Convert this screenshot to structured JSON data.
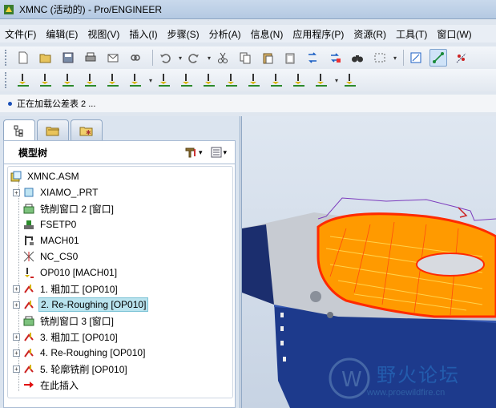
{
  "window": {
    "title": "XMNC (活动的) - Pro/ENGINEER"
  },
  "menu": [
    "文件(F)",
    "编辑(E)",
    "视图(V)",
    "插入(I)",
    "步骤(S)",
    "分析(A)",
    "信息(N)",
    "应用程序(P)",
    "资源(R)",
    "工具(T)",
    "窗口(W)"
  ],
  "status": {
    "message": "正在加载公差表 2 ..."
  },
  "panel": {
    "title": "模型树",
    "tabs": [
      "model-tree-tab",
      "layer-tab",
      "favorites-tab"
    ]
  },
  "tree": [
    {
      "label": "XMNC.ASM",
      "icon": "assembly-icon",
      "expandable": false,
      "indent": 0
    },
    {
      "label": "XIAMO_.PRT",
      "icon": "part-icon",
      "expandable": true,
      "indent": 1
    },
    {
      "label": "铣削窗口 2 [窗口]",
      "icon": "mill-window-icon",
      "expandable": false,
      "indent": 1
    },
    {
      "label": "FSETP0",
      "icon": "fixture-icon",
      "expandable": false,
      "indent": 1
    },
    {
      "label": "MACH01",
      "icon": "machine-icon",
      "expandable": false,
      "indent": 1
    },
    {
      "label": "NC_CS0",
      "icon": "coordinate-system-icon",
      "expandable": false,
      "indent": 1
    },
    {
      "label": "OP010 [MACH01]",
      "icon": "operation-icon",
      "expandable": false,
      "indent": 1
    },
    {
      "label": "1. 粗加工 [OP010]",
      "icon": "nc-sequence-icon",
      "expandable": true,
      "indent": 1
    },
    {
      "label": "2. Re-Roughing [OP010]",
      "icon": "nc-sequence-icon",
      "expandable": true,
      "indent": 1,
      "selected": true
    },
    {
      "label": "铣削窗口 3 [窗口]",
      "icon": "mill-window-icon",
      "expandable": false,
      "indent": 1
    },
    {
      "label": "3. 粗加工 [OP010]",
      "icon": "nc-sequence-icon",
      "expandable": true,
      "indent": 1
    },
    {
      "label": "4. Re-Roughing [OP010]",
      "icon": "nc-sequence-icon",
      "expandable": true,
      "indent": 1
    },
    {
      "label": "5. 轮廓铣削 [OP010]",
      "icon": "nc-sequence-icon",
      "expandable": true,
      "indent": 1
    },
    {
      "label": "在此插入",
      "icon": "insert-here-arrow-icon",
      "expandable": false,
      "indent": 1
    }
  ],
  "watermark": {
    "text": "野火论坛",
    "url": "www.proewildfire.cn"
  },
  "colors": {
    "toolpath": "#ff9a00",
    "toolpath_edge": "#ff2a00",
    "base": "#1d3a8c",
    "selection": "#b9e3ee"
  }
}
